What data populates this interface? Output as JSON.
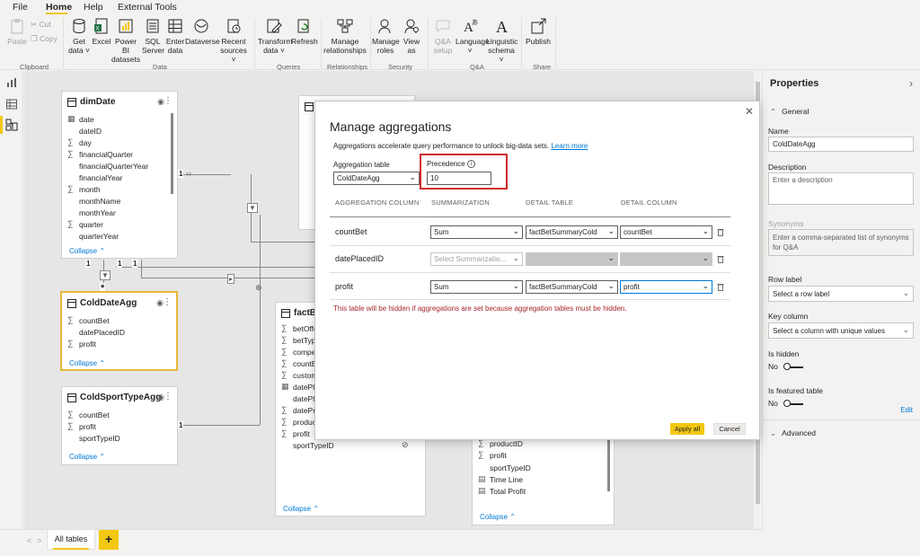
{
  "menu": {
    "items": [
      "File",
      "Home",
      "Help",
      "External Tools"
    ],
    "active": "Home"
  },
  "ribbon": {
    "clipboard": {
      "paste": "Paste",
      "cut": "Cut",
      "copy": "Copy",
      "label": "Clipboard"
    },
    "data": {
      "get_data": "Get\ndata ˅",
      "excel": "Excel",
      "powerbi": "Power BI\ndatasets",
      "sql": "SQL\nServer",
      "enter": "Enter\ndata",
      "dataverse": "Dataverse",
      "recent": "Recent\nsources ˅",
      "label": "Data"
    },
    "queries": {
      "transform": "Transform\ndata ˅",
      "refresh": "Refresh",
      "label": "Queries"
    },
    "relationships": {
      "manage": "Manage\nrelationships",
      "label": "Relationships"
    },
    "security": {
      "roles": "Manage\nroles",
      "view_as": "View\nas",
      "label": "Security"
    },
    "qa": {
      "setup": "Q&A\nsetup",
      "language": "Language\n˅",
      "schema": "Linguistic\nschema ˅",
      "label": "Q&A"
    },
    "share": {
      "publish": "Publish",
      "label": "Share"
    }
  },
  "tables": {
    "dimDate": {
      "title": "dimDate",
      "fields": [
        {
          "icon": "table",
          "name": "date"
        },
        {
          "icon": "",
          "name": "dateID"
        },
        {
          "icon": "sigma",
          "name": "day"
        },
        {
          "icon": "sigma",
          "name": "financialQuarter"
        },
        {
          "icon": "",
          "name": "financialQuarterYear"
        },
        {
          "icon": "",
          "name": "financialYear"
        },
        {
          "icon": "sigma",
          "name": "month"
        },
        {
          "icon": "",
          "name": "monthName"
        },
        {
          "icon": "",
          "name": "monthYear"
        },
        {
          "icon": "sigma",
          "name": "quarter"
        },
        {
          "icon": "",
          "name": "quarterYear"
        }
      ],
      "collapse": "Collapse"
    },
    "coldDateAgg": {
      "title": "ColdDateAgg",
      "fields": [
        {
          "icon": "sigma",
          "name": "countBet"
        },
        {
          "icon": "",
          "name": "datePlacedID"
        },
        {
          "icon": "sigma",
          "name": "profit"
        }
      ],
      "collapse": "Collapse"
    },
    "coldSportTypeAgg": {
      "title": "ColdSportTypeAgg",
      "fields": [
        {
          "icon": "sigma",
          "name": "countBet"
        },
        {
          "icon": "sigma",
          "name": "profit"
        },
        {
          "icon": "",
          "name": "sportTypeID"
        }
      ],
      "collapse": "Collapse"
    },
    "factBet": {
      "title": "factBe",
      "fields": [
        {
          "icon": "sigma",
          "name": "betOffe"
        },
        {
          "icon": "sigma",
          "name": "betType"
        },
        {
          "icon": "sigma",
          "name": "compet"
        },
        {
          "icon": "sigma",
          "name": "countBe"
        },
        {
          "icon": "sigma",
          "name": "custom"
        },
        {
          "icon": "table",
          "name": "datePla"
        },
        {
          "icon": "",
          "name": "datePla"
        },
        {
          "icon": "sigma",
          "name": "datePro"
        },
        {
          "icon": "sigma",
          "name": "product"
        },
        {
          "icon": "sigma",
          "name": "profit"
        },
        {
          "icon": "",
          "name": "sportTypeID"
        }
      ],
      "collapse": "Collapse"
    },
    "fourth": {
      "fields": [
        {
          "icon": "sigma",
          "name": "productID"
        },
        {
          "icon": "sigma",
          "name": "profit"
        },
        {
          "icon": "",
          "name": "sportTypeID"
        },
        {
          "icon": "calc",
          "name": "Time Line"
        },
        {
          "icon": "calc",
          "name": "Total Profit"
        }
      ],
      "collapse": "Collapse"
    }
  },
  "relationship_labels": [
    "1",
    "1",
    "1",
    "1",
    "1",
    "*"
  ],
  "tabs": {
    "all_tables": "All tables",
    "add": "+",
    "prev": "<",
    "next": ">"
  },
  "properties": {
    "title": "Properties",
    "general": "General",
    "name_label": "Name",
    "name_value": "ColdDateAgg",
    "description_label": "Description",
    "description_placeholder": "Enter a description",
    "synonyms_label": "Synonyms",
    "synonyms_placeholder": "Enter a comma-separated list of synonyms for Q&A",
    "row_label": "Row label",
    "row_label_value": "Select a row label",
    "key_column": "Key column",
    "key_column_value": "Select a column with unique values",
    "is_hidden": "Is hidden",
    "is_hidden_value": "No",
    "is_featured": "Is featured table",
    "is_featured_value": "No",
    "edit": "Edit",
    "advanced": "Advanced"
  },
  "modal": {
    "title": "Manage aggregations",
    "description": "Aggregations accelerate query performance to unlock big-data sets.",
    "learn_more": "Learn more",
    "agg_table_label": "Aggregation table",
    "agg_table_value": "ColdDateAgg",
    "precedence_label": "Precedence",
    "precedence_value": "10",
    "columns": [
      "AGGREGATION COLUMN",
      "SUMMARIZATION",
      "DETAIL TABLE",
      "DETAIL COLUMN"
    ],
    "rows": [
      {
        "column": "countBet",
        "summarization": "Sum",
        "detail_table": "factBetSummaryCold",
        "detail_column": "countBet"
      },
      {
        "column": "datePlacedID",
        "summarization": "Select Summarizatio...",
        "detail_table": "",
        "detail_column": ""
      },
      {
        "column": "profit",
        "summarization": "Sum",
        "detail_table": "factBetSummaryCold",
        "detail_column": "profit"
      }
    ],
    "warning": "This table will be hidden if aggregations are set because aggregation tables must be hidden.",
    "apply": "Apply all",
    "cancel": "Cancel",
    "close": "✕"
  },
  "colors": {
    "accent": "#f2c811",
    "link": "#0078d4",
    "warning": "#a4262c",
    "highlight": "#d0282b"
  }
}
